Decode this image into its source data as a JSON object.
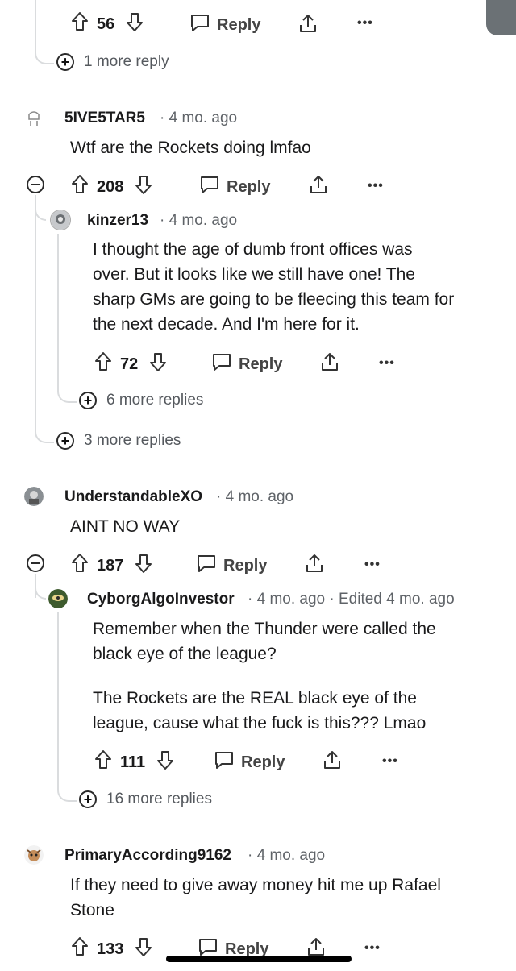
{
  "comments": {
    "c0": {
      "upvotes": "56",
      "reply": "Reply",
      "more": "1 more reply",
      "dots": "•••"
    },
    "c1": {
      "user": "5IVE5TAR5",
      "age": "· 4 mo. ago",
      "body": "Wtf are the Rockets doing lmfao",
      "upvotes": "208",
      "reply": "Reply",
      "dots": "•••",
      "more": "3 more replies"
    },
    "c1r": {
      "user": "kinzer13",
      "age": "· 4 mo. ago",
      "lines": [
        "I thought the age of dumb front offices was",
        "over. But it looks like we still have one! The",
        "sharp GMs are going to be fleecing this team for",
        "the next decade. And I'm here for it."
      ],
      "upvotes": "72",
      "reply": "Reply",
      "dots": "•••",
      "more": "6 more replies"
    },
    "c2": {
      "user": "UnderstandableXO",
      "age": "· 4 mo. ago",
      "body": "AINT NO WAY",
      "upvotes": "187",
      "reply": "Reply",
      "dots": "•••"
    },
    "c2r": {
      "user": "CyborgAlgoInvestor",
      "age": "· 4 mo. ago · Edited 4 mo. ago",
      "lines": [
        "Remember when the Thunder were called the",
        "black eye of the league?",
        "",
        "The Rockets are the REAL black eye of the",
        "league, cause what the fuck is this??? Lmao"
      ],
      "upvotes": "111",
      "reply": "Reply",
      "dots": "•••",
      "more": "16 more replies"
    },
    "c3": {
      "user": "PrimaryAccording9162",
      "age": "· 4 mo. ago",
      "lines": [
        "If they need to give away money hit me up Rafael",
        "Stone"
      ],
      "upvotes": "133",
      "reply": "Reply",
      "dots": "•••"
    }
  },
  "colors": {
    "thread": "#dadcde",
    "meta": "#5f6368",
    "text": "#1a1a1b"
  }
}
